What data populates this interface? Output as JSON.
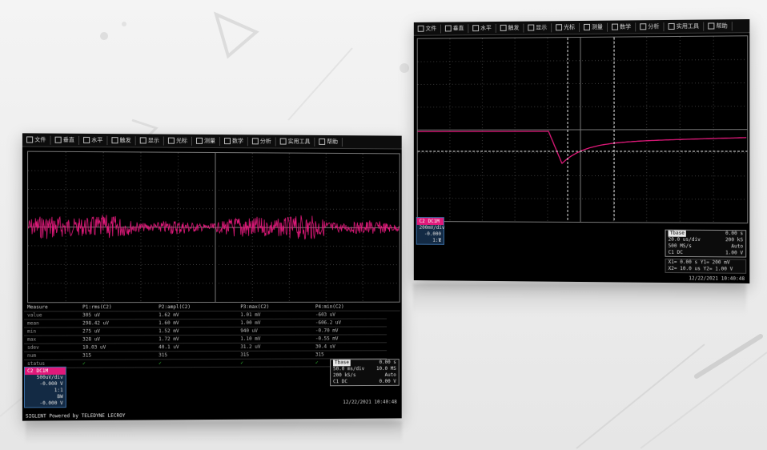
{
  "colors": {
    "trace": "#e0197a",
    "grid": "#5a5a5a",
    "background": "#000000",
    "pass": "#3bd13b",
    "channel_box": "#132a44"
  },
  "left_scope": {
    "menu": [
      {
        "label": "文件",
        "icon": "file-icon"
      },
      {
        "label": "垂直",
        "icon": "vertical-icon"
      },
      {
        "label": "水平",
        "icon": "horizontal-icon"
      },
      {
        "label": "触发",
        "icon": "trigger-icon"
      },
      {
        "label": "显示",
        "icon": "display-icon"
      },
      {
        "label": "光标",
        "icon": "cursor-icon"
      },
      {
        "label": "测量",
        "icon": "measure-icon"
      },
      {
        "label": "数学",
        "icon": "math-icon"
      },
      {
        "label": "分析",
        "icon": "analysis-icon"
      },
      {
        "label": "实用工具",
        "icon": "utility-icon"
      },
      {
        "label": "帮助",
        "icon": "help-icon"
      }
    ],
    "measure_table": {
      "headers": [
        "Measure",
        "P1:rms(C2)",
        "P2:ampl(C2)",
        "P3:max(C2)",
        "P4:min(C2)",
        "",
        ""
      ],
      "rows": [
        {
          "label": "value",
          "cells": [
            "305 uV",
            "1.62 mV",
            "1.01 mV",
            "-603 uV"
          ]
        },
        {
          "label": "mean",
          "cells": [
            "298.42 uV",
            "1.60 mV",
            "1.00 mV",
            "-606.2 uV"
          ]
        },
        {
          "label": "min",
          "cells": [
            "275 uV",
            "1.52 mV",
            "940 uV",
            "-0.70 mV"
          ]
        },
        {
          "label": "max",
          "cells": [
            "328 uV",
            "1.72 mV",
            "1.10 mV",
            "-0.55 mV"
          ]
        },
        {
          "label": "sdev",
          "cells": [
            "10.03 uV",
            "40.1 uV",
            "31.2 uV",
            "30.4 uV"
          ]
        },
        {
          "label": "num",
          "cells": [
            "315",
            "315",
            "315",
            "315"
          ]
        },
        {
          "label": "status",
          "cells": [
            "✓",
            "✓",
            "✓",
            "✓"
          ]
        }
      ]
    },
    "channel_box": {
      "label": "C2",
      "coupling": "DC1M",
      "rows": [
        "500uV/div",
        "-0.000 V",
        "1:1",
        "BW",
        "-0.000 V"
      ]
    },
    "timebase": {
      "title": "Tbase",
      "value": "0.00 s",
      "rows": [
        [
          "50.0 ms/div",
          "10.0 MS"
        ],
        [
          "200 kS/s",
          "Auto"
        ],
        [
          "C1 DC",
          "0.00 V"
        ]
      ]
    },
    "status_right": "12/22/2021 10:40:48",
    "status_left": "SIGLENT Powered by TELEDYNE LECROY"
  },
  "right_scope": {
    "menu": [
      {
        "label": "文件",
        "icon": "file-icon"
      },
      {
        "label": "垂直",
        "icon": "vertical-icon"
      },
      {
        "label": "水平",
        "icon": "horizontal-icon"
      },
      {
        "label": "触发",
        "icon": "trigger-icon"
      },
      {
        "label": "显示",
        "icon": "display-icon"
      },
      {
        "label": "光标",
        "icon": "cursor-icon"
      },
      {
        "label": "测量",
        "icon": "measure-icon"
      },
      {
        "label": "数学",
        "icon": "math-icon"
      },
      {
        "label": "分析",
        "icon": "analysis-icon"
      },
      {
        "label": "实用工具",
        "icon": "utility-icon"
      },
      {
        "label": "帮助",
        "icon": "help-icon"
      }
    ],
    "channel_box": {
      "label": "C2",
      "coupling": "DC1M",
      "rows": [
        "200mV/div",
        "-0.000 V",
        "1:1"
      ]
    },
    "timebase": {
      "title": "Tbase",
      "value": "0.00 s",
      "rows": [
        [
          "20.0 us/div",
          "200 kS"
        ],
        [
          "500 MS/s",
          "Auto"
        ],
        [
          "C1 DC",
          "1.00 V"
        ]
      ]
    },
    "cursor_readout": [
      "X1= 0.00 s   Y1= 200 mV",
      "X2= 10.0 us  Y2= 1.00 V"
    ],
    "status_right": "12/22/2021 10:40:48"
  }
}
